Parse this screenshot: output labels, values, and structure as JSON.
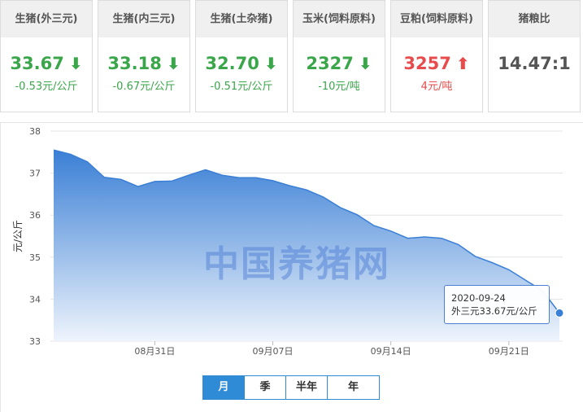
{
  "cards": [
    {
      "title": "生猪(外三元)",
      "value": "33.67",
      "arrow": "⬇",
      "change": "-0.53元/公斤",
      "trend": "down"
    },
    {
      "title": "生猪(内三元)",
      "value": "33.18",
      "arrow": "⬇",
      "change": "-0.67元/公斤",
      "trend": "down"
    },
    {
      "title": "生猪(土杂猪)",
      "value": "32.70",
      "arrow": "⬇",
      "change": "-0.51元/公斤",
      "trend": "down"
    },
    {
      "title": "玉米(饲料原料)",
      "value": "2327",
      "arrow": "⬇",
      "change": "-10元/吨",
      "trend": "down"
    },
    {
      "title": "豆粕(饲料原料)",
      "value": "3257",
      "arrow": "⬆",
      "change": "4元/吨",
      "trend": "up"
    },
    {
      "title": "猪粮比",
      "value": "14.47:1",
      "arrow": "",
      "change": "",
      "trend": "neutral"
    }
  ],
  "watermark": "中国养猪网",
  "tooltip": {
    "date": "2020-09-24",
    "text": "外三元33.67元/公斤"
  },
  "range_tabs": [
    "月",
    "季",
    "半年",
    "年"
  ],
  "active_tab": 0,
  "colors": {
    "line": "#3a7fd5",
    "area_top": "#3a7fd5",
    "area_bottom": "#eef4fc",
    "down": "#3aa64a",
    "up": "#e84b4b"
  },
  "chart_data": {
    "type": "area",
    "ylabel": "元/公斤",
    "ylim": [
      33,
      38
    ],
    "yticks": [
      33,
      34,
      35,
      36,
      37,
      38
    ],
    "x": [
      "2020-08-25",
      "2020-08-26",
      "2020-08-27",
      "2020-08-28",
      "2020-08-29",
      "2020-08-30",
      "2020-08-31",
      "2020-09-01",
      "2020-09-02",
      "2020-09-03",
      "2020-09-04",
      "2020-09-05",
      "2020-09-06",
      "2020-09-07",
      "2020-09-08",
      "2020-09-09",
      "2020-09-10",
      "2020-09-11",
      "2020-09-12",
      "2020-09-13",
      "2020-09-14",
      "2020-09-15",
      "2020-09-16",
      "2020-09-17",
      "2020-09-18",
      "2020-09-19",
      "2020-09-20",
      "2020-09-21",
      "2020-09-22",
      "2020-09-23",
      "2020-09-24"
    ],
    "xticks": [
      {
        "date": "2020-08-31",
        "label": "08月31日"
      },
      {
        "date": "2020-09-07",
        "label": "09月07日"
      },
      {
        "date": "2020-09-14",
        "label": "09月14日"
      },
      {
        "date": "2020-09-21",
        "label": "09月21日"
      }
    ],
    "series": [
      {
        "name": "外三元",
        "values": [
          37.55,
          37.45,
          37.27,
          36.9,
          36.85,
          36.68,
          36.8,
          36.81,
          36.95,
          37.08,
          36.95,
          36.89,
          36.89,
          36.82,
          36.7,
          36.6,
          36.43,
          36.18,
          36.01,
          35.75,
          35.62,
          35.45,
          35.48,
          35.45,
          35.3,
          35.02,
          34.87,
          34.7,
          34.45,
          34.2,
          33.67
        ]
      }
    ],
    "grid": true,
    "legend": "none"
  }
}
